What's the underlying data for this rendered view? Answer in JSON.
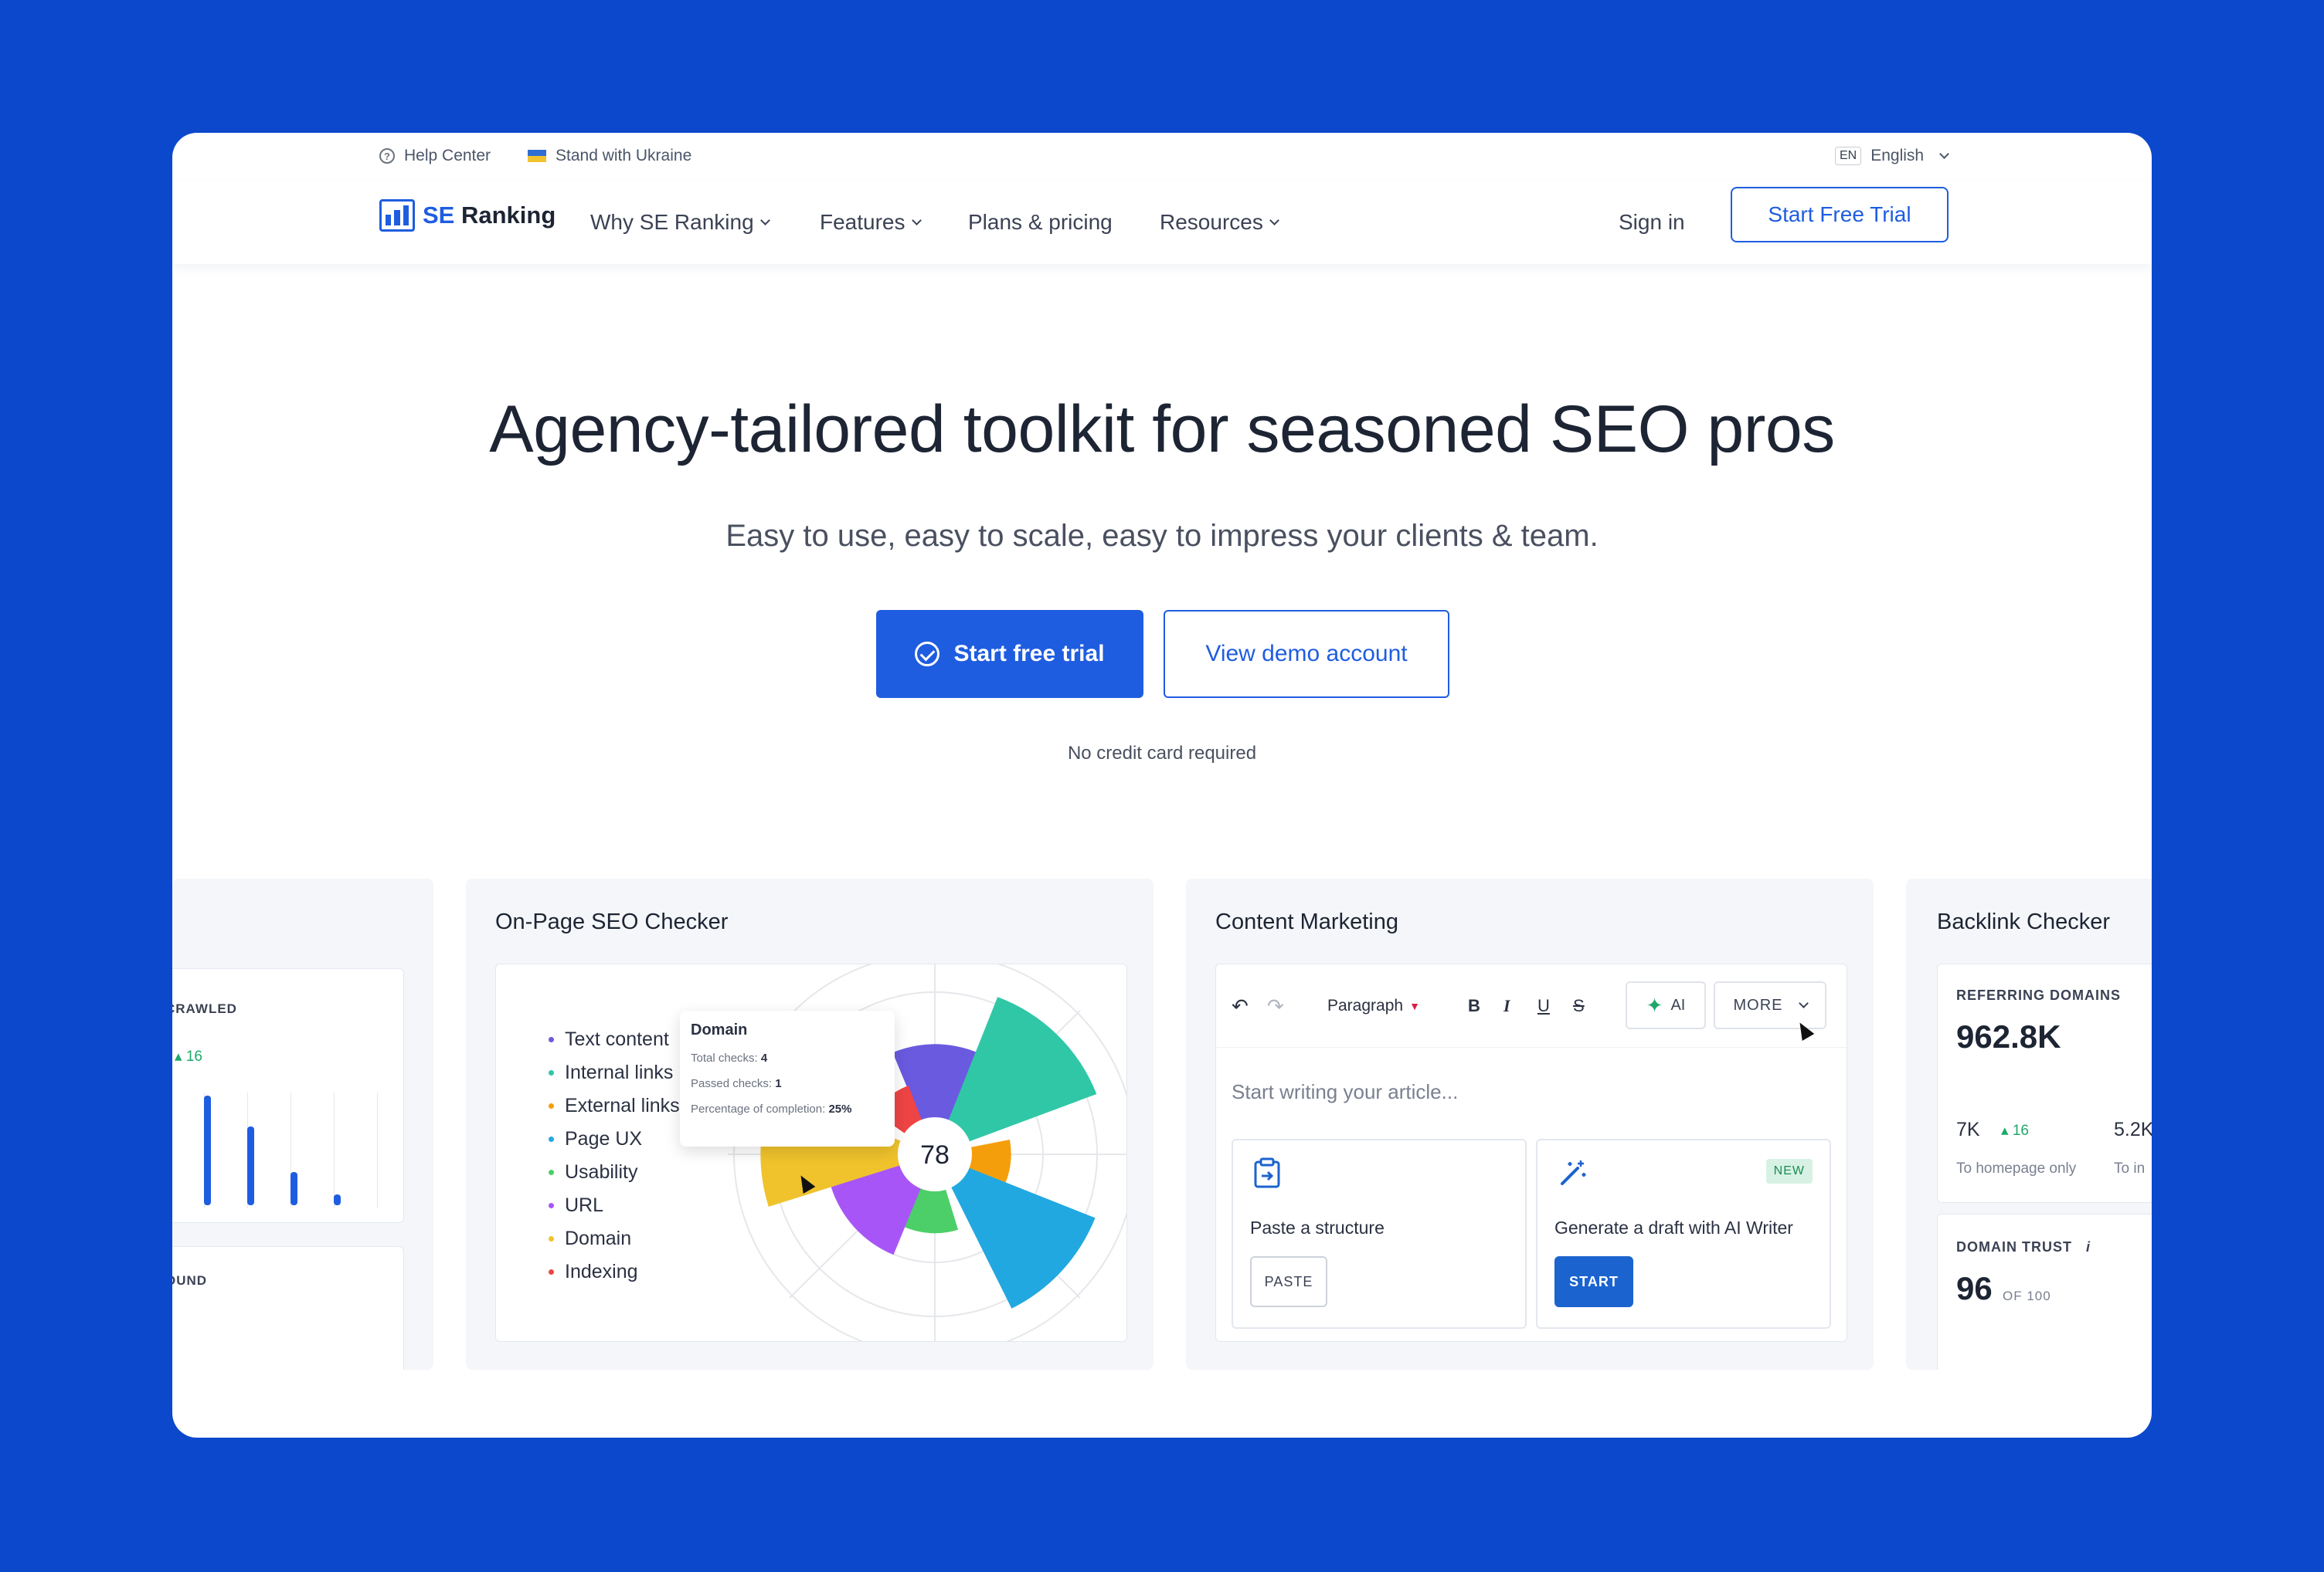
{
  "utility": {
    "help": "Help Center",
    "ukraine": "Stand with Ukraine",
    "lang_code": "EN",
    "lang": "English"
  },
  "nav": {
    "logo_se": "SE",
    "logo_ranking": "Ranking",
    "items": [
      "Why SE Ranking",
      "Features",
      "Plans & pricing",
      "Resources"
    ],
    "signin": "Sign in",
    "trial": "Start Free Trial"
  },
  "hero": {
    "title": "Agency-tailored toolkit for seasoned SEO pros",
    "subtitle": "Easy to use, easy to scale, easy to impress your clients & team.",
    "primary_cta": "Start free trial",
    "secondary_cta": "View demo account",
    "note": "No credit card required"
  },
  "cards": {
    "left": {
      "crawled_label": "CRAWLED",
      "crawled_delta": "16",
      "found_label": "OUND",
      "bar_levels": [
        1.0,
        0.72,
        0.3,
        0.1
      ]
    },
    "onpage": {
      "title": "On-Page SEO Checker",
      "legend": [
        {
          "label": "Text content",
          "color": "#6a5ae0"
        },
        {
          "label": "Internal links",
          "color": "#30c7a7"
        },
        {
          "label": "External links",
          "color": "#f59e0b"
        },
        {
          "label": "Page UX",
          "color": "#22a8e0"
        },
        {
          "label": "Usability",
          "color": "#4ccf68"
        },
        {
          "label": "URL",
          "color": "#a855f7"
        },
        {
          "label": "Domain",
          "color": "#f0c32c"
        },
        {
          "label": "Indexing",
          "color": "#ef4444"
        }
      ],
      "score": "78",
      "tooltip": {
        "title": "Domain",
        "total_label": "Total checks:",
        "total": "4",
        "passed_label": "Passed checks:",
        "passed": "1",
        "pct_label": "Percentage of completion:",
        "pct": "25%"
      }
    },
    "content": {
      "title": "Content Marketing",
      "paragraph": "Paragraph",
      "ai": "AI",
      "more": "MORE",
      "placeholder": "Start writing your article...",
      "paste_structure": "Paste a structure",
      "paste_btn": "PASTE",
      "generate": "Generate a draft with AI Writer",
      "new_badge": "NEW",
      "start_btn": "START"
    },
    "backlink": {
      "title": "Backlink Checker",
      "ref_label": "REFERRING DOMAINS",
      "ref_value": "962.8K",
      "homepage_value": "7K",
      "homepage_delta": "16",
      "homepage_caption": "To homepage only",
      "inner_value": "5.2K",
      "inner_caption": "To in",
      "trust_label": "DOMAIN TRUST",
      "trust_info": "i",
      "trust_value": "96",
      "trust_of": "OF 100"
    }
  },
  "colors": {
    "brand_blue": "#1f5de0",
    "background": "#0b48cc",
    "positive": "#1ea86a"
  }
}
